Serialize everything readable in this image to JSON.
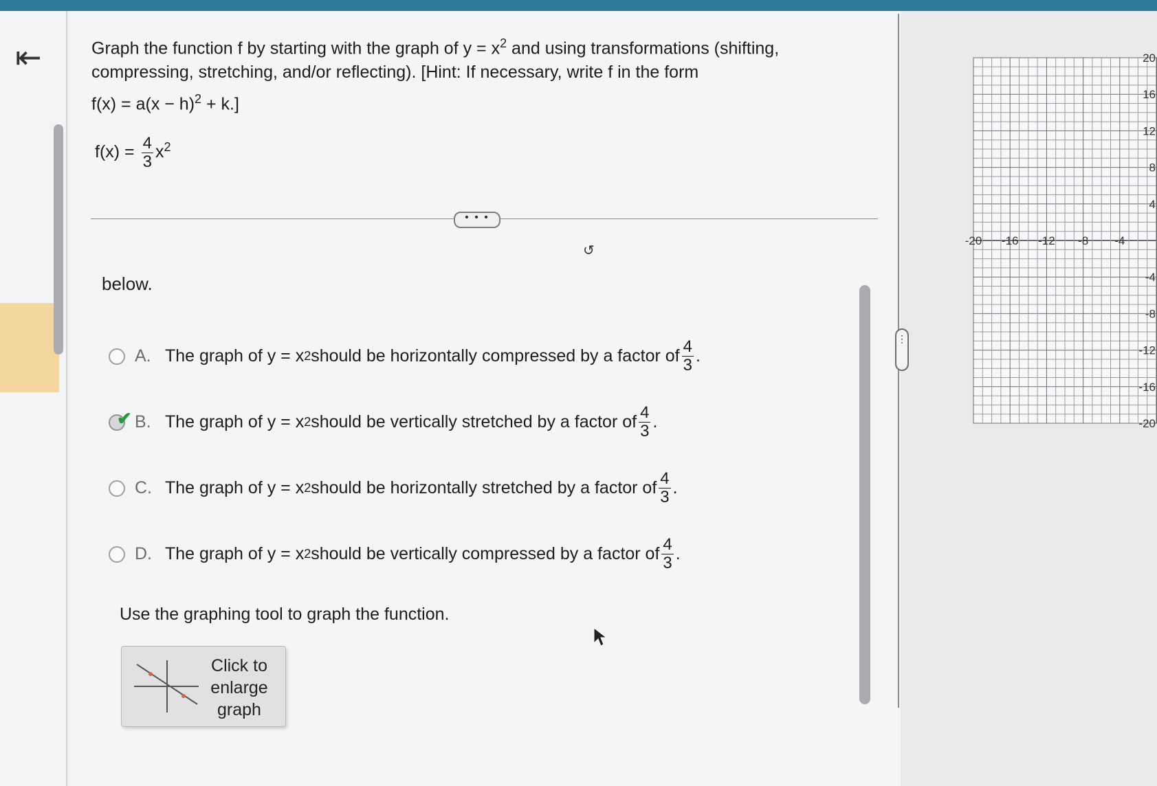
{
  "nav": {
    "back_icon": "⇤"
  },
  "question": {
    "line1_a": "Graph the function f by starting with the graph of y = x",
    "line1_b": " and using transformations (shifting,",
    "line2": "compressing, stretching, and/or reflecting). [Hint: If necessary, write f in the form",
    "hint_formula_a": "f(x) = a(x − h)",
    "hint_formula_b": " + k.]",
    "exp": "2"
  },
  "function": {
    "lhs": "f(x) = ",
    "num": "4",
    "den": "3",
    "var": "x",
    "exp": "2"
  },
  "more_button": "• • •",
  "spinner": "↺",
  "below_text": "below.",
  "options": [
    {
      "letter": "A.",
      "pre": "The graph of y = x",
      "exp": "2",
      "post": " should be horizontally compressed by a factor of",
      "num": "4",
      "den": "3",
      "end": ".",
      "selected": false
    },
    {
      "letter": "B.",
      "pre": "The graph of y = x",
      "exp": "2",
      "post": " should be vertically stretched by a factor of",
      "num": "4",
      "den": "3",
      "end": ".",
      "selected": true
    },
    {
      "letter": "C.",
      "pre": "The graph of y = x",
      "exp": "2",
      "post": " should be horizontally stretched by a factor of",
      "num": "4",
      "den": "3",
      "end": ".",
      "selected": false
    },
    {
      "letter": "D.",
      "pre": "The graph of y = x",
      "exp": "2",
      "post": " should be vertically compressed by a factor of",
      "num": "4",
      "den": "3",
      "end": ".",
      "selected": false
    }
  ],
  "check_mark": "✔",
  "instruction": "Use the graphing tool to graph the function.",
  "enlarge_button": {
    "line1": "Click to",
    "line2": "enlarge",
    "line3": "graph"
  },
  "handle_dots": "⋮",
  "graph": {
    "x_ticks": [
      "-20",
      "-16",
      "-12",
      "-8",
      "-4"
    ],
    "y_ticks": [
      "20",
      "16",
      "12",
      "8",
      "4",
      "-4",
      "-8",
      "-12",
      "-16",
      "-20"
    ]
  }
}
